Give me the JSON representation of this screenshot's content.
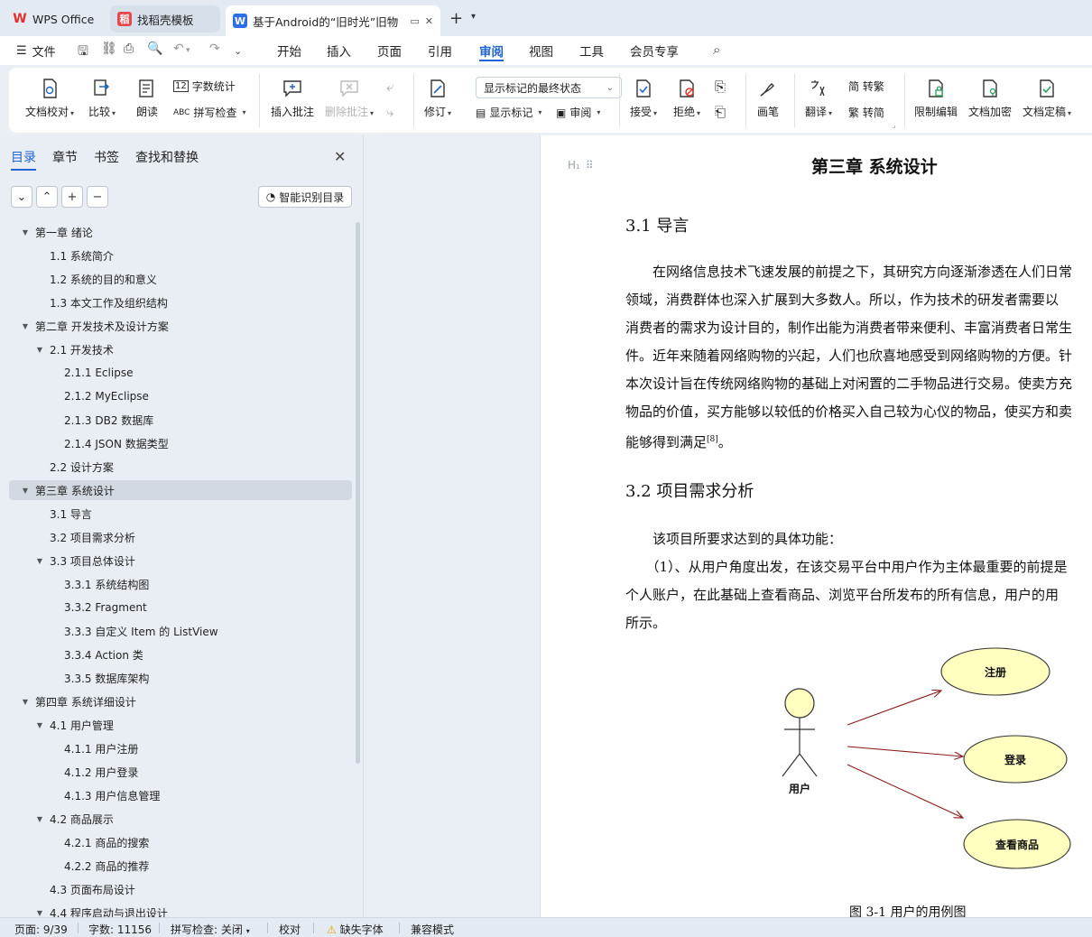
{
  "tabs": [
    {
      "label": "WPS Office",
      "icon": "wps-logo-icon"
    },
    {
      "label": "找稻壳模板",
      "icon": "docer-logo-icon"
    },
    {
      "label": "基于Android的“旧时光”旧物",
      "icon": "writer-logo-icon"
    }
  ],
  "menubar": {
    "file": "文件",
    "items": [
      "开始",
      "插入",
      "页面",
      "引用",
      "审阅",
      "视图",
      "工具",
      "会员专享"
    ],
    "active": "审阅"
  },
  "ribbon": {
    "doc_check": "文档校对",
    "compare": "比较",
    "read_aloud": "朗读",
    "word_count": "字数统计",
    "spell_check": "拼写检查",
    "insert_comment": "插入批注",
    "delete_comment": "删除批注",
    "track_changes": "修订",
    "markup_state": "显示标记的最终状态",
    "show_markup": "显示标记",
    "review_pane": "审阅",
    "accept": "接受",
    "reject": "拒绝",
    "pen": "画笔",
    "translate": "翻译",
    "to_traditional": "简 转繁",
    "to_simplified": "繁 转简",
    "restrict_edit": "限制编辑",
    "encrypt": "文档加密",
    "finalize": "文档定稿"
  },
  "nav": {
    "tabs": [
      "目录",
      "章节",
      "书签",
      "查找和替换"
    ],
    "active_tab": "目录",
    "smart_toc": "智能识别目录",
    "toc": [
      {
        "level": 0,
        "toggle": "▼",
        "text": "第一章   绪论"
      },
      {
        "level": 1,
        "toggle": "",
        "text": "1.1 系统简介"
      },
      {
        "level": 1,
        "toggle": "",
        "text": "1.2 系统的目的和意义"
      },
      {
        "level": 1,
        "toggle": "",
        "text": "1.3 本文工作及组织结构"
      },
      {
        "level": 0,
        "toggle": "▼",
        "text": "第二章  开发技术及设计方案"
      },
      {
        "level": 1,
        "toggle": "▼",
        "text": "2.1  开发技术"
      },
      {
        "level": 2,
        "toggle": "",
        "text": "2.1.1 Eclipse"
      },
      {
        "level": 2,
        "toggle": "",
        "text": "2.1.2 MyEclipse"
      },
      {
        "level": 2,
        "toggle": "",
        "text": "2.1.3 DB2 数据库"
      },
      {
        "level": 2,
        "toggle": "",
        "text": "2.1.4 JSON 数据类型"
      },
      {
        "level": 1,
        "toggle": "",
        "text": "2.2 设计方案"
      },
      {
        "level": 0,
        "toggle": "▼",
        "text": "第三章  系统设计",
        "selected": true
      },
      {
        "level": 1,
        "toggle": "",
        "text": "3.1 导言"
      },
      {
        "level": 1,
        "toggle": "",
        "text": "3.2 项目需求分析"
      },
      {
        "level": 1,
        "toggle": "▼",
        "text": "3.3 项目总体设计"
      },
      {
        "level": 2,
        "toggle": "",
        "text": "3.3.1 系统结构图"
      },
      {
        "level": 2,
        "toggle": "",
        "text": "3.3.2 Fragment"
      },
      {
        "level": 2,
        "toggle": "",
        "text": "3.3.3 自定义 Item 的 ListView"
      },
      {
        "level": 2,
        "toggle": "",
        "text": "3.3.4 Action 类"
      },
      {
        "level": 2,
        "toggle": "",
        "text": "3.3.5  数据库架构"
      },
      {
        "level": 0,
        "toggle": "▼",
        "text": "第四章  系统详细设计"
      },
      {
        "level": 1,
        "toggle": "▼",
        "text": "4.1  用户管理"
      },
      {
        "level": 2,
        "toggle": "",
        "text": "4.1.1 用户注册"
      },
      {
        "level": 2,
        "toggle": "",
        "text": "4.1.2 用户登录"
      },
      {
        "level": 2,
        "toggle": "",
        "text": "4.1.3  用户信息管理"
      },
      {
        "level": 1,
        "toggle": "▼",
        "text": "4.2  商品展示"
      },
      {
        "level": 2,
        "toggle": "",
        "text": "4.2.1 商品的搜索"
      },
      {
        "level": 2,
        "toggle": "",
        "text": "4.2.2 商品的推荐"
      },
      {
        "level": 1,
        "toggle": "",
        "text": "4.3  页面布局设计"
      },
      {
        "level": 1,
        "toggle": "▼",
        "text": "4.4  程序启动与退出设计"
      }
    ]
  },
  "document": {
    "chapter_title": "第三章  系统设计",
    "sec1_title": "3.1 导言",
    "sec1_lines": [
      "　　在网络信息技术飞速发展的前提之下，其研究方向逐渐渗透在人们日常",
      "领域，消费群体也深入扩展到大多数人。所以，作为技术的研发者需要以",
      "消费者的需求为设计目的，制作出能为消费者带来便利、丰富消费者日常生",
      "件。近年来随着网络购物的兴起，人们也欣喜地感受到网络购物的方便。针",
      "本次设计旨在传统网络购物的基础上对闲置的二手物品进行交易。使卖方充",
      "物品的价值，买方能够以较低的价格买入自己较为心仪的物品，使买方和卖",
      "能够得到满足"
    ],
    "sec1_citation": "[8]",
    "sec1_end": "。",
    "sec2_title": "3.2 项目需求分析",
    "sec2_lines": [
      "　　该项目所要求达到的具体功能：",
      "　　（1）、从用户角度出发，在该交易平台中用户作为主体最重要的前提是",
      "个人账户，在此基础上查看商品、浏览平台所发布的所有信息，用户的用",
      "所示。"
    ],
    "diagram": {
      "actor": "用户",
      "usecases": [
        "注册",
        "登录",
        "查看商品"
      ]
    },
    "caption": "图 3-1  用户的用例图"
  },
  "statusbar": {
    "page": "页面: 9/39",
    "words": "字数: 11156",
    "spell": "拼写检查: 关闭",
    "proof": "校对",
    "missing_font": "缺失字体",
    "compat": "兼容模式"
  },
  "colors": {
    "accent": "#2264d1",
    "usecase_fill": "#ffffc0",
    "arrow": "#8b1a1a"
  }
}
